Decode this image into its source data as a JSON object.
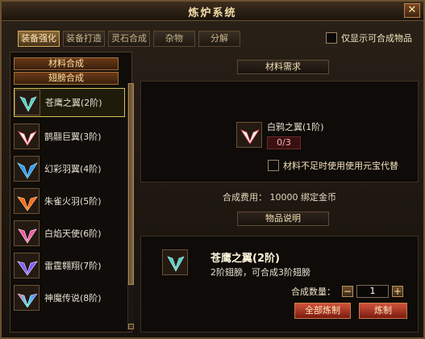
{
  "window": {
    "title": "炼炉系统",
    "close": "✕"
  },
  "tabs": [
    "装备强化",
    "装备打造",
    "灵石合成",
    "杂物",
    "分解"
  ],
  "active_tab_index": 0,
  "only_show": "仅显示可合成物品",
  "left": {
    "categories": [
      "材料合成",
      "翅膀合成"
    ],
    "items": [
      {
        "label": "苍鹰之翼(2阶)",
        "icon": "teal-wings-icon",
        "selected": true
      },
      {
        "label": "鹊翮巨翼(3阶)",
        "icon": "white-wings-icon"
      },
      {
        "label": "幻彩羽翼(4阶)",
        "icon": "cyan-wings-icon"
      },
      {
        "label": "朱雀火羽(5阶)",
        "icon": "fire-wings-icon"
      },
      {
        "label": "白焰天使(6阶)",
        "icon": "pink-wings-icon"
      },
      {
        "label": "雷霆翱翔(7阶)",
        "icon": "purple-wings-icon"
      },
      {
        "label": "神魔传说(8阶)",
        "icon": "rainbow-wings-icon"
      }
    ]
  },
  "materials": {
    "header": "材料需求",
    "item_name": "白鸦之翼(1阶)",
    "count": "0/3",
    "replace_label": "材料不足时使用使用元宝代替"
  },
  "cost": {
    "label": "合成费用：",
    "value": "10000 绑定金币"
  },
  "result": {
    "header": "物品说明",
    "title": "苍鹰之翼(2阶)",
    "desc": "2阶翅膀，可合成3阶翅膀",
    "qty_label": "合成数量：",
    "qty_value": "1",
    "minus": "−",
    "plus": "+",
    "btn_all": "全部炼制",
    "btn_one": "炼制"
  },
  "colors": {
    "accent": "#d6a85e",
    "danger": "#b72d1e"
  }
}
